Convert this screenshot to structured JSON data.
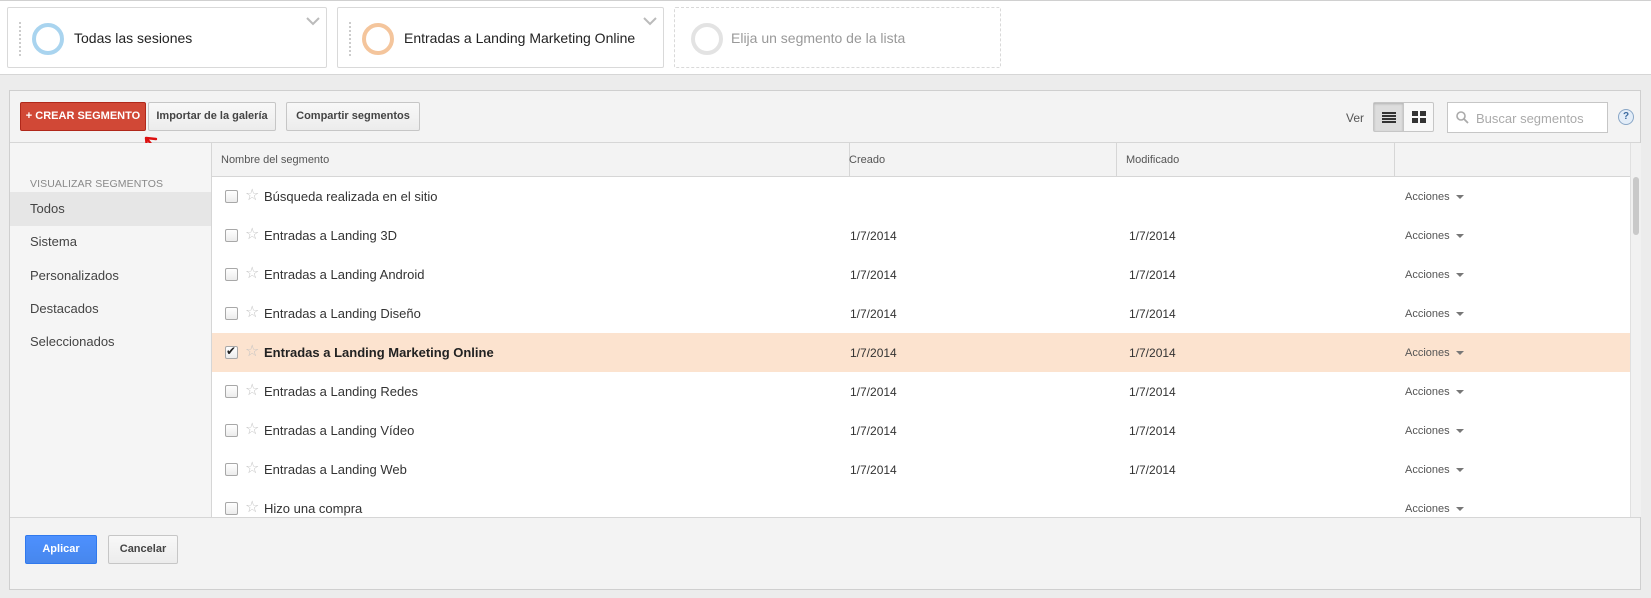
{
  "segments_bar": {
    "segments": [
      {
        "label": "Todas las sesiones",
        "color": "#a9d4ef"
      },
      {
        "label": "Entradas a Landing Marketing Online",
        "color": "#f4c59c"
      }
    ],
    "placeholder": "Elija un segmento de la lista"
  },
  "toolbar": {
    "create_label": "+ CREAR SEGMENTO",
    "import_label": "Importar de la galería",
    "share_label": "Compartir segmentos",
    "view_label": "Ver",
    "search_placeholder": "Buscar segmentos",
    "help_label": "?"
  },
  "sidebar": {
    "title": "VISUALIZAR SEGMENTOS",
    "items": [
      {
        "label": "Todos",
        "active": true
      },
      {
        "label": "Sistema"
      },
      {
        "label": "Personalizados"
      },
      {
        "label": "Destacados"
      },
      {
        "label": "Seleccionados"
      }
    ]
  },
  "table": {
    "columns": [
      "Nombre del segmento",
      "Creado",
      "Modificado",
      ""
    ],
    "action_label": "Acciones",
    "rows": [
      {
        "name": "Búsqueda realizada en el sitio",
        "created": "",
        "modified": "",
        "checked": false
      },
      {
        "name": "Entradas a Landing 3D",
        "created": "1/7/2014",
        "modified": "1/7/2014",
        "checked": false
      },
      {
        "name": "Entradas a Landing Android",
        "created": "1/7/2014",
        "modified": "1/7/2014",
        "checked": false
      },
      {
        "name": "Entradas a Landing Diseño",
        "created": "1/7/2014",
        "modified": "1/7/2014",
        "checked": false
      },
      {
        "name": "Entradas a Landing Marketing Online",
        "created": "1/7/2014",
        "modified": "1/7/2014",
        "checked": true
      },
      {
        "name": "Entradas a Landing Redes",
        "created": "1/7/2014",
        "modified": "1/7/2014",
        "checked": false
      },
      {
        "name": "Entradas a Landing Vídeo",
        "created": "1/7/2014",
        "modified": "1/7/2014",
        "checked": false
      },
      {
        "name": "Entradas a Landing Web",
        "created": "1/7/2014",
        "modified": "1/7/2014",
        "checked": false
      },
      {
        "name": "Hizo una compra",
        "created": "",
        "modified": "",
        "checked": false
      }
    ]
  },
  "footer": {
    "apply_label": "Aplicar",
    "cancel_label": "Cancelar"
  },
  "colors": {
    "accent_red": "#d14836",
    "accent_blue": "#4d90fe",
    "selected_row": "#fce3cf"
  }
}
